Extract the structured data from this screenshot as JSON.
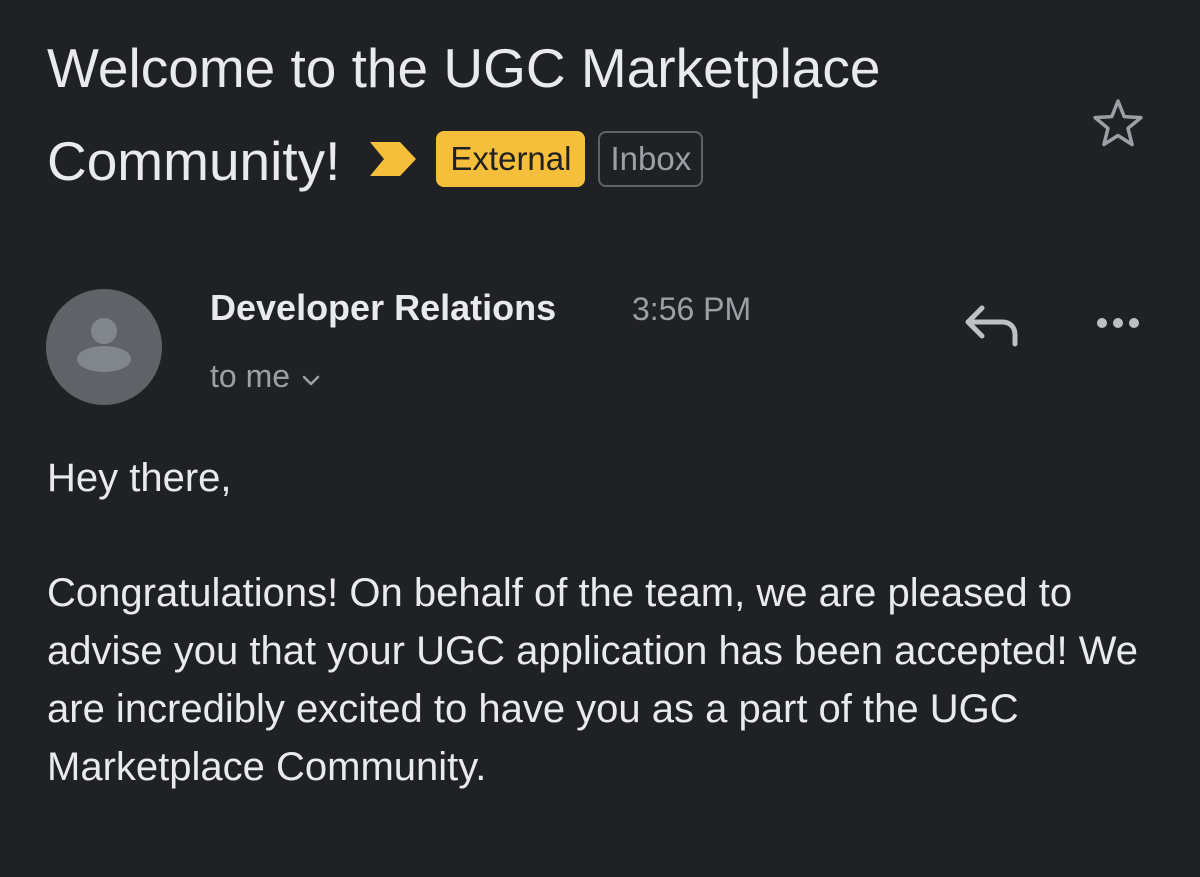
{
  "email": {
    "subject_line1": "Welcome to the UGC Marketplace",
    "subject_line2": "Community!",
    "labels": {
      "external": "External",
      "inbox": "Inbox"
    },
    "sender": {
      "name": "Developer Relations",
      "time": "3:56 PM",
      "recipient": "to me"
    },
    "body": {
      "greeting": "Hey there,",
      "paragraph": "Congratulations! On behalf of the team, we are pleased to advise you that your UGC application has been accepted! We are incredibly excited to have you as a part of the UGC Marketplace Community."
    }
  },
  "icons": {
    "importance": "importance-marker-icon",
    "star": "star-icon",
    "avatar": "person-icon",
    "recipient_expand": "chevron-down-icon",
    "reply": "reply-icon",
    "more": "more-horizontal-icon"
  },
  "colors": {
    "background": "#202124",
    "text_primary": "#e8eaed",
    "text_secondary": "#9aa0a6",
    "external_label": "#f6bf3b",
    "inbox_border": "#5f6368",
    "avatar_bg": "#5f6368"
  }
}
